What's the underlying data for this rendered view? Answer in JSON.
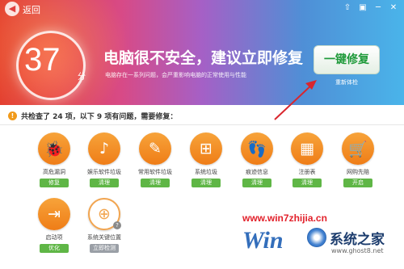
{
  "window": {
    "back_label": "返回",
    "controls": [
      "⇧",
      "▣",
      "─",
      "✕"
    ]
  },
  "header": {
    "score": "37",
    "score_unit": "分",
    "headline": "电脑很不安全，建议立即修复",
    "subline": "电脑存在一系列问题，会严重影响电脑的正常使用与性能",
    "fix_button": "一键修复",
    "recheck_link": "重新体检"
  },
  "summary": {
    "text": "共检查了 24 项，以下 9 项有问题，需要修复："
  },
  "items": [
    {
      "label": "高危漏洞",
      "action": "修复",
      "icon": "bug-icon",
      "glyph": "🐞"
    },
    {
      "label": "娱乐软件垃圾",
      "action": "清理",
      "icon": "music-note-icon",
      "glyph": "♪"
    },
    {
      "label": "常用软件垃圾",
      "action": "清理",
      "icon": "broom-icon",
      "glyph": "✎"
    },
    {
      "label": "系统垃圾",
      "action": "清理",
      "icon": "windows-logo-icon",
      "glyph": "⊞"
    },
    {
      "label": "痕迹信息",
      "action": "清理",
      "icon": "footprint-icon",
      "glyph": "👣"
    },
    {
      "label": "注册表",
      "action": "清理",
      "icon": "registry-blocks-icon",
      "glyph": "▦"
    },
    {
      "label": "网购先赔",
      "action": "开启",
      "icon": "shopping-cart-icon",
      "glyph": "🛒"
    },
    {
      "label": "启动项",
      "action": "优化",
      "icon": "startup-arrow-icon",
      "glyph": "⇥"
    },
    {
      "label": "系统关键位置",
      "action": "立即检测",
      "icon": "crosshair-icon",
      "glyph": "⊕"
    }
  ],
  "watermark": {
    "url": "www.win7zhijia.cn",
    "logo": "Win",
    "name": "系统之家",
    "site": "www.ghost8.net"
  },
  "colors": {
    "accent_orange": "#ef7d17",
    "action_green": "#5fb646",
    "fix_green": "#1f9a3a"
  }
}
